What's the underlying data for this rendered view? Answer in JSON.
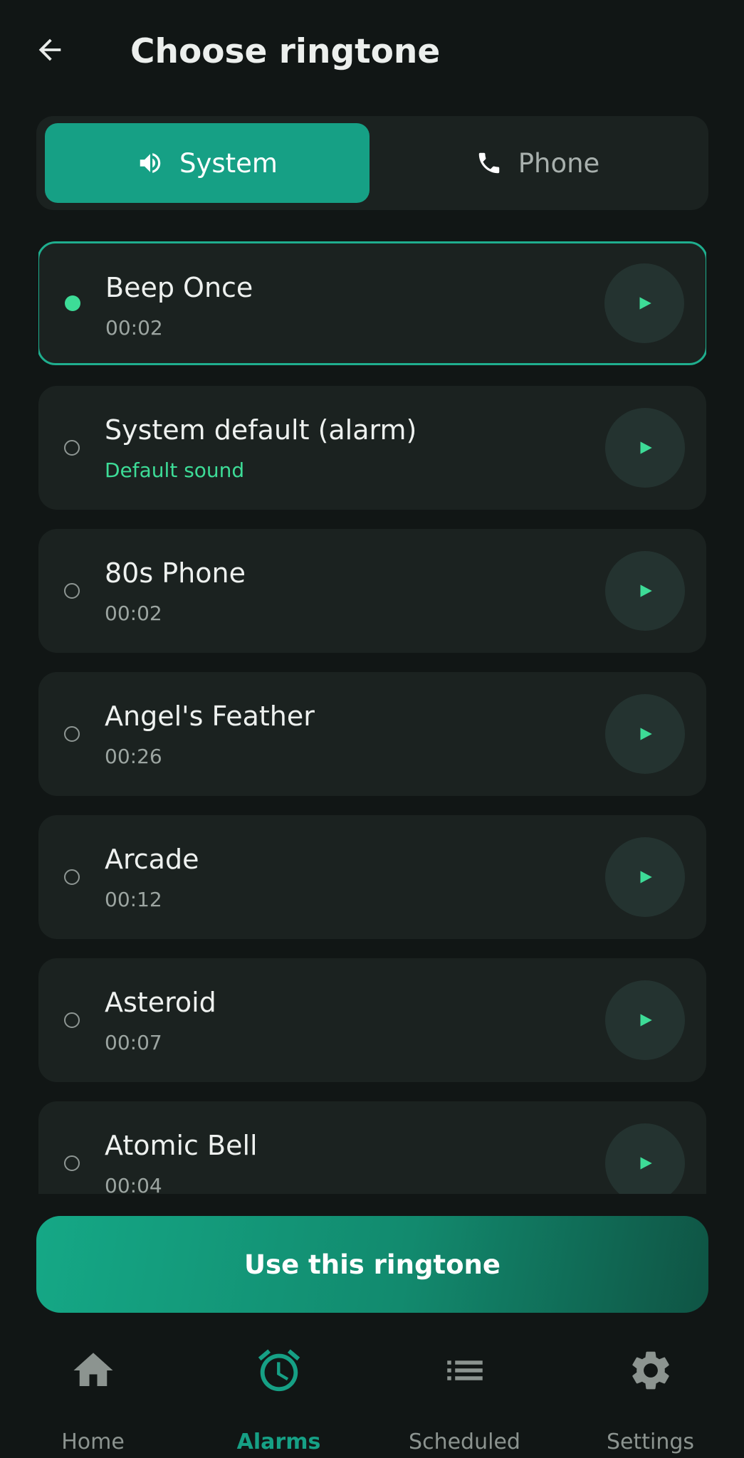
{
  "header": {
    "title": "Choose ringtone",
    "back_icon": "arrow-left-icon"
  },
  "segments": [
    {
      "label": "System",
      "icon": "speaker-icon",
      "active": true
    },
    {
      "label": "Phone",
      "icon": "phone-icon",
      "active": false
    }
  ],
  "ringtones": [
    {
      "name": "Beep Once",
      "sub": "00:02",
      "selected": true
    },
    {
      "name": "System default (alarm)",
      "sub": "Default sound",
      "selected": false
    },
    {
      "name": "80s Phone",
      "sub": "00:02",
      "selected": false
    },
    {
      "name": "Angel's Feather",
      "sub": "00:26",
      "selected": false
    },
    {
      "name": "Arcade",
      "sub": "00:12",
      "selected": false
    },
    {
      "name": "Asteroid",
      "sub": "00:07",
      "selected": false
    },
    {
      "name": "Atomic Bell",
      "sub": "00:04",
      "selected": false
    }
  ],
  "cta": {
    "label": "Use this ringtone"
  },
  "bottom_nav": [
    {
      "label": "Home",
      "icon": "home-icon",
      "active": false
    },
    {
      "label": "Alarms",
      "icon": "alarm-clock-icon",
      "active": true
    },
    {
      "label": "Scheduled",
      "icon": "list-icon",
      "active": false
    },
    {
      "label": "Settings",
      "icon": "gear-icon",
      "active": false
    }
  ],
  "colors": {
    "background": "#111615",
    "card": "#1b2220",
    "accent": "#16a085",
    "accent_bright": "#3ddc97",
    "muted_text": "#9ca5a1"
  }
}
